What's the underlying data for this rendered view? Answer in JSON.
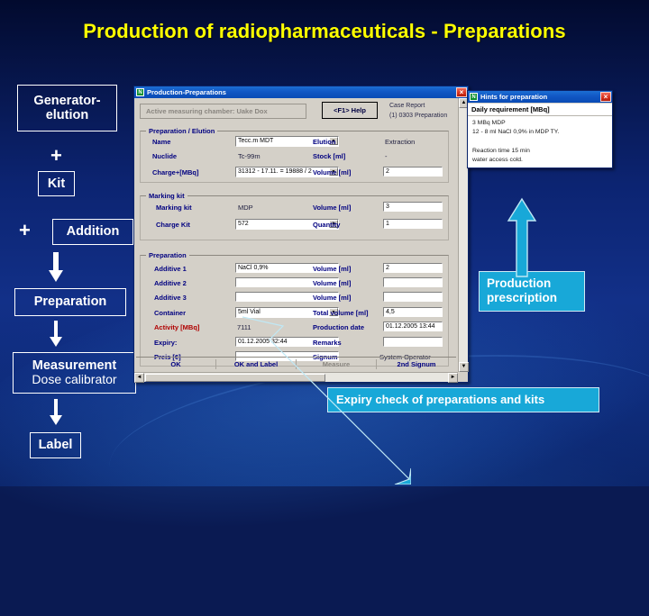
{
  "slide": {
    "title": "Production of radiopharmaceuticals - Preparations",
    "title_color": "#ffff00",
    "background_color": "#0c2472",
    "accent_color": "#18a8d8"
  },
  "flow": {
    "generator": "Generator-\nelution",
    "generator_line1": "Generator-",
    "generator_line2": "elution",
    "plus1": "+",
    "kit": "Kit",
    "plus2": "+",
    "addition": "Addition",
    "preparation": "Preparation",
    "measurement_line1": "Measurement",
    "measurement_line2": "Dose calibrator",
    "label": "Label"
  },
  "callouts": {
    "production_prescription_line1": "Production",
    "production_prescription_line2": "prescription",
    "expiry_check": "Expiry check of preparations and kits"
  },
  "main_window": {
    "title": "Production-Preparations",
    "icon": "app-icon",
    "close_label": "×",
    "active_chamber_button": "Active measuring chamber:   Uake Dox",
    "help_button": "<F1> Help",
    "top_info_line1": "Case Report",
    "top_info_line2": "(1) 0303   Preparation",
    "groups": {
      "elution": {
        "title": "Preparation / Elution",
        "fields": [
          {
            "label": "Name",
            "type": "combo",
            "value": "Tecc.m MDT"
          },
          {
            "label": "Nuclide",
            "type": "static",
            "value": "Tc-99m"
          },
          {
            "label": "Charge+[MBq]",
            "type": "combo",
            "value": "31312 - 17.11. = 19888 / 2"
          },
          {
            "label": "Elution",
            "type": "static",
            "value": "Extraction"
          },
          {
            "label": "Stock [ml]",
            "type": "static",
            "value": "-"
          },
          {
            "label": "Volume [ml]",
            "type": "input",
            "value": "2"
          }
        ]
      },
      "marking_kit": {
        "title": "Marking kit",
        "fields": [
          {
            "label": "Marking kit",
            "type": "static",
            "value": "MDP"
          },
          {
            "label": "Charge Kit",
            "type": "combo",
            "value": "572"
          },
          {
            "label": "Volume [ml]",
            "type": "input",
            "value": "3"
          },
          {
            "label": "Quantity",
            "type": "input",
            "value": "1"
          }
        ]
      },
      "preparation": {
        "title": "Preparation",
        "left_fields": [
          {
            "label": "Additive 1",
            "type": "input",
            "value": "NaCl 0,9%"
          },
          {
            "label": "Additive 2",
            "type": "input",
            "value": ""
          },
          {
            "label": "Additive 3",
            "type": "input",
            "value": ""
          },
          {
            "label": "Container",
            "type": "combo",
            "value": "5ml Vial"
          },
          {
            "label": "Activity [MBq]",
            "type": "static",
            "value": "7111",
            "label_color": "#b00000"
          },
          {
            "label": "Expiry:",
            "type": "input",
            "value": "01.12.2005 32:44"
          },
          {
            "label": "Preis [€]",
            "type": "input",
            "value": ""
          }
        ],
        "right_fields": [
          {
            "label": "Volume [ml]",
            "type": "input",
            "value": "2"
          },
          {
            "label": "Volume [ml]",
            "type": "input",
            "value": ""
          },
          {
            "label": "Volume [ml]",
            "type": "input",
            "value": ""
          },
          {
            "label": "Total volume [ml]",
            "type": "input",
            "value": "4,5"
          },
          {
            "label": "Production date",
            "type": "input",
            "value": "01.12.2005 13:44"
          },
          {
            "label": "Remarks",
            "type": "input",
            "value": ""
          },
          {
            "label": "Signum",
            "type": "static",
            "value": "System Operator"
          }
        ]
      }
    },
    "buttons": [
      {
        "label": "OK",
        "enabled": true
      },
      {
        "label": "OK and Label",
        "enabled": true
      },
      {
        "label": "Measure",
        "enabled": false
      },
      {
        "label": "2nd Signum",
        "enabled": true
      }
    ],
    "scrollbar_up": "▲",
    "scrollbar_down": "▼",
    "scrollbar_left": "◄",
    "scrollbar_right": "►"
  },
  "hints_window": {
    "title": "Hints for preparation",
    "close_label": "×",
    "header": "Daily requirement [MBq]",
    "body": "3 MBq MDP\n12 - 8 ml NaCl 0,9% in MDP TY.\n\nReaction time 15 min\nwater access cold."
  }
}
